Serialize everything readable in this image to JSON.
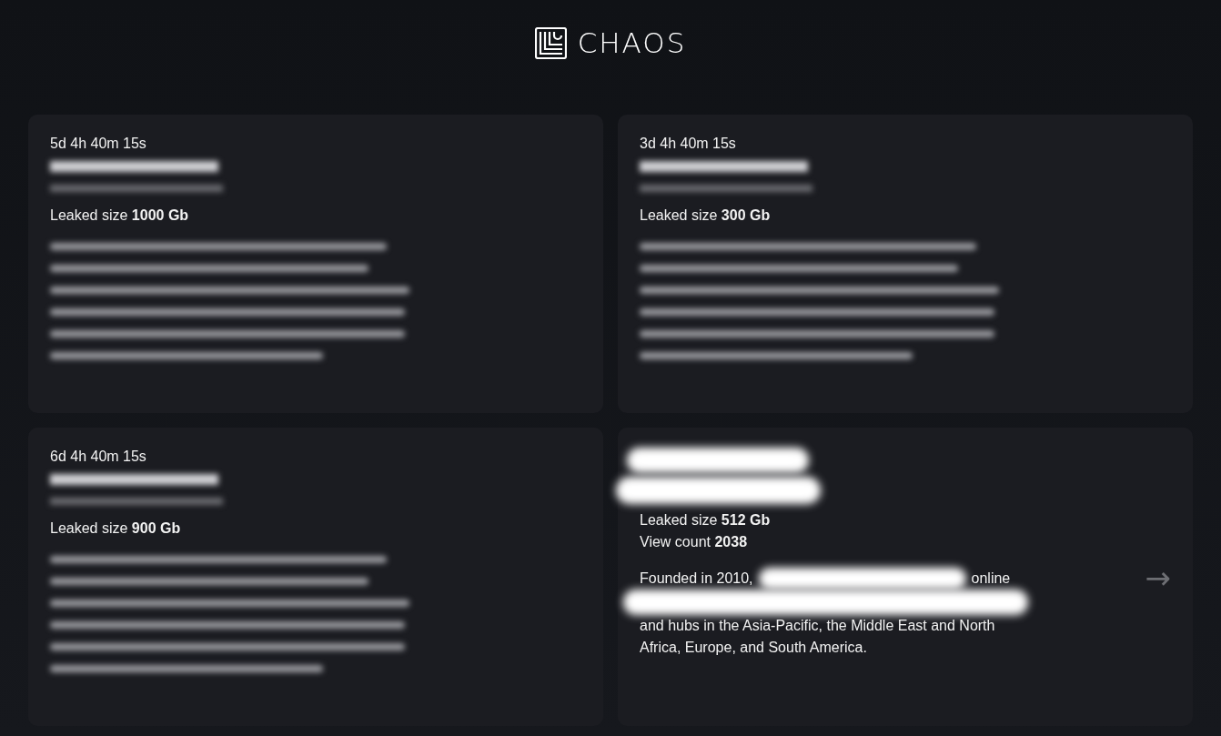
{
  "logo": {
    "text": "CHAOS"
  },
  "posts": [
    {
      "kind": "blurred",
      "timer": "5d 4h 40m 15s",
      "size_label": "Leaked size",
      "size": "1000 Gb"
    },
    {
      "kind": "blurred",
      "timer": "3d 4h 40m 15s",
      "size_label": "Leaked size",
      "size": "300 Gb"
    },
    {
      "kind": "blurred",
      "timer": "6d 4h 40m 15s",
      "size_label": "Leaked size",
      "size": "900 Gb"
    },
    {
      "kind": "redacted",
      "size_label": "Leaked size",
      "size": "512 Gb",
      "views_label": "View count",
      "views": "2038",
      "description": {
        "start": "Founded in 2010,",
        "after_cover": "online",
        "rest": "and hubs in the Asia-Pacific, the Middle East and North Africa, Europe, and South America."
      },
      "next_arrow": "→"
    }
  ]
}
